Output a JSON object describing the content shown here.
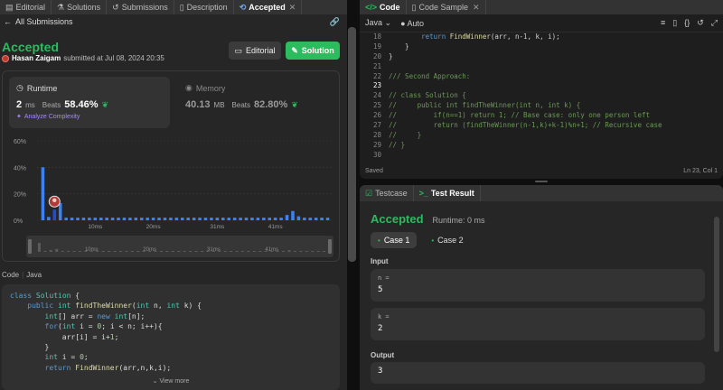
{
  "left": {
    "tabs": [
      {
        "label": "Editorial",
        "icon": "book-icon"
      },
      {
        "label": "Solutions",
        "icon": "flask-icon"
      },
      {
        "label": "Submissions",
        "icon": "history-icon"
      },
      {
        "label": "Description",
        "icon": "doc-icon"
      },
      {
        "label": "Accepted",
        "icon": "refresh-icon",
        "close": "✕"
      }
    ],
    "back_label": "All Submissions",
    "status": "Accepted",
    "submitter": "Hasan Zaigam",
    "submitted_text": "submitted at Jul 08, 2024 20:35",
    "editorial_btn": "Editorial",
    "solution_btn": "Solution",
    "runtime": {
      "label": "Runtime",
      "value": "2",
      "unit": "ms",
      "beats_label": "Beats",
      "percent": "58.46%",
      "analyze": "Analyze Complexity"
    },
    "memory": {
      "label": "Memory",
      "value": "40.13",
      "unit": "MB",
      "beats_label": "Beats",
      "percent": "82.80%"
    },
    "code_lang_header": "Code",
    "code_lang": "Java",
    "view_more": "View more"
  },
  "chart_data": {
    "type": "bar",
    "title": "",
    "xlabel": "",
    "ylabel": "",
    "ylim": [
      0,
      60
    ],
    "y_ticks": [
      "0%",
      "20%",
      "40%",
      "60%"
    ],
    "x_ticks": [
      {
        "x": 10,
        "label": "10ms"
      },
      {
        "x": 20,
        "label": "20ms"
      },
      {
        "x": 31,
        "label": "31ms"
      },
      {
        "x": 41,
        "label": "41ms"
      }
    ],
    "x_range": [
      0,
      51
    ],
    "x": [
      1,
      2,
      3,
      4,
      5,
      6,
      7,
      8,
      9,
      10,
      11,
      12,
      13,
      14,
      15,
      16,
      17,
      18,
      19,
      20,
      21,
      22,
      23,
      24,
      25,
      26,
      27,
      28,
      29,
      30,
      31,
      32,
      33,
      34,
      35,
      36,
      37,
      38,
      39,
      40,
      41,
      42,
      43,
      44,
      45,
      46,
      47,
      48,
      49,
      50
    ],
    "values": [
      40,
      2.5,
      8,
      13,
      2,
      2,
      2,
      2,
      2,
      2,
      2,
      2,
      2,
      2,
      2,
      2,
      2,
      2,
      2,
      2,
      2,
      2,
      2,
      2,
      2,
      2,
      2,
      2,
      2,
      2,
      2,
      2,
      2,
      2,
      2,
      2,
      2,
      2,
      2,
      2,
      2,
      2,
      4,
      7,
      3,
      2,
      2,
      2,
      2,
      2
    ],
    "highlight_x": 3,
    "scrubber_ticks": [
      "10ms",
      "20ms",
      "31ms",
      "41ms"
    ],
    "bar_color": "#3b82f6",
    "highlight_color": "#1d4ed8"
  },
  "left_code": [
    "class Solution {",
    "    public int findTheWinner(int n, int k) {",
    "        int[] arr = new int[n];",
    "        for(int i = 0; i < n; i++){",
    "            arr[i] = i+1;",
    "        }",
    "        int i = 0;",
    "        return FindWinner(arr,n,k,i);"
  ],
  "right": {
    "tabs": [
      {
        "label": "Code",
        "icon": "code-icon"
      },
      {
        "label": "Code Sample",
        "icon": "doc-icon"
      }
    ],
    "language": "Java",
    "mode": "Auto",
    "lines": [
      {
        "n": "18",
        "t": "        return FindWinner(arr, n-1, k, i);"
      },
      {
        "n": "19",
        "t": "    }"
      },
      {
        "n": "20",
        "t": "}"
      },
      {
        "n": "21",
        "t": ""
      },
      {
        "n": "22",
        "t": "/// Second Approach:"
      },
      {
        "n": "23",
        "t": ""
      },
      {
        "n": "24",
        "t": "// class Solution {"
      },
      {
        "n": "25",
        "t": "//     public int findTheWinner(int n, int k) {"
      },
      {
        "n": "26",
        "t": "//         if(n==1) return 1; // Base case: only one person left"
      },
      {
        "n": "27",
        "t": "//         return (findTheWinner(n-1,k)+k-1)%n+1; // Recursive case"
      },
      {
        "n": "28",
        "t": "//     }"
      },
      {
        "n": "29",
        "t": "// }"
      },
      {
        "n": "30",
        "t": ""
      }
    ],
    "status_left": "Saved",
    "status_right": "Ln 23, Col 1",
    "result_tabs": [
      {
        "label": "Testcase",
        "icon": "checkbox-icon"
      },
      {
        "label": "Test Result",
        "icon": "terminal-icon"
      }
    ],
    "result_status": "Accepted",
    "result_runtime": "Runtime: 0 ms",
    "cases": [
      "Case 1",
      "Case 2"
    ],
    "input_label": "Input",
    "inputs": [
      {
        "name": "n =",
        "value": "5"
      },
      {
        "name": "k =",
        "value": "2"
      }
    ],
    "output_label": "Output",
    "output_value": "3"
  }
}
